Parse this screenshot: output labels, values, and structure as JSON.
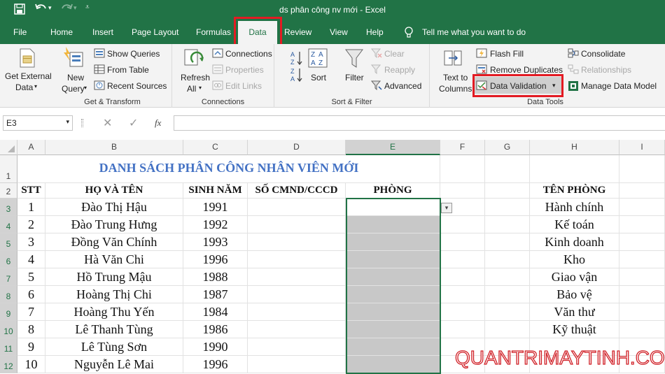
{
  "window": {
    "title": "ds phân công nv mới  -  Excel"
  },
  "menu": {
    "tabs": [
      "File",
      "Home",
      "Insert",
      "Page Layout",
      "Formulas",
      "Data",
      "Review",
      "View",
      "Help"
    ],
    "active": "Data",
    "tell_me": "Tell me what you want to do"
  },
  "ribbon": {
    "get_external": {
      "line1": "Get External",
      "line2": "Data"
    },
    "new_query": {
      "line1": "New",
      "line2": "Query"
    },
    "show_queries": "Show Queries",
    "from_table": "From Table",
    "recent_sources": "Recent Sources",
    "group_get_transform": "Get & Transform",
    "refresh": {
      "line1": "Refresh",
      "line2": "All"
    },
    "connections": "Connections",
    "properties": "Properties",
    "edit_links": "Edit Links",
    "group_connections": "Connections",
    "sort": "Sort",
    "filter": "Filter",
    "clear": "Clear",
    "reapply": "Reapply",
    "advanced": "Advanced",
    "group_sort_filter": "Sort & Filter",
    "text_to_columns": {
      "line1": "Text to",
      "line2": "Columns"
    },
    "flash_fill": "Flash Fill",
    "remove_duplicates": "Remove Duplicates",
    "data_validation": "Data Validation",
    "consolidate": "Consolidate",
    "relationships": "Relationships",
    "manage_data_model": "Manage Data Model",
    "group_data_tools": "Data Tools"
  },
  "formula_bar": {
    "name_box": "E3",
    "formula": "",
    "fx": "fx"
  },
  "sheet": {
    "columns": [
      "A",
      "B",
      "C",
      "D",
      "E",
      "F",
      "G",
      "H",
      "I"
    ],
    "selected_column": "E",
    "rows": [
      "1",
      "2",
      "3",
      "4",
      "5",
      "6",
      "7",
      "8",
      "9",
      "10",
      "11",
      "12"
    ],
    "title": "DANH SÁCH PHÂN CÔNG NHÂN VIÊN MỚI",
    "headers": {
      "stt": "STT",
      "name": "HỌ VÀ TÊN",
      "year": "SINH NĂM",
      "id": "SỐ CMND/CCCD",
      "dept": "PHÒNG",
      "dept_name": "TÊN PHÒNG"
    },
    "employees": [
      {
        "stt": "1",
        "name": "Đào Thị Hậu",
        "year": "1991"
      },
      {
        "stt": "2",
        "name": "Đào Trung Hưng",
        "year": "1992"
      },
      {
        "stt": "3",
        "name": "Đồng Văn Chính",
        "year": "1993"
      },
      {
        "stt": "4",
        "name": "Hà Văn Chi",
        "year": "1996"
      },
      {
        "stt": "5",
        "name": "Hồ Trung Mậu",
        "year": "1988"
      },
      {
        "stt": "6",
        "name": "Hoàng Thị Chi",
        "year": "1987"
      },
      {
        "stt": "7",
        "name": "Hoàng Thu Yến",
        "year": "1984"
      },
      {
        "stt": "8",
        "name": "Lê Thanh Tùng",
        "year": "1986"
      },
      {
        "stt": "9",
        "name": "Lê Tùng Sơn",
        "year": "1990"
      },
      {
        "stt": "10",
        "name": "Nguyễn Lê Mai",
        "year": "1996"
      }
    ],
    "departments": [
      "Hành chính",
      "Kế toán",
      "Kinh doanh",
      "Kho",
      "Giao vận",
      "Bảo vệ",
      "Văn thư",
      "Kỹ thuật"
    ]
  },
  "watermark": "QUANTRIMAYTINH.COM",
  "colors": {
    "excel_green": "#217346",
    "highlight_red": "#e31b23",
    "title_blue": "#4472c4",
    "shade_gray": "#c8c8c8"
  }
}
